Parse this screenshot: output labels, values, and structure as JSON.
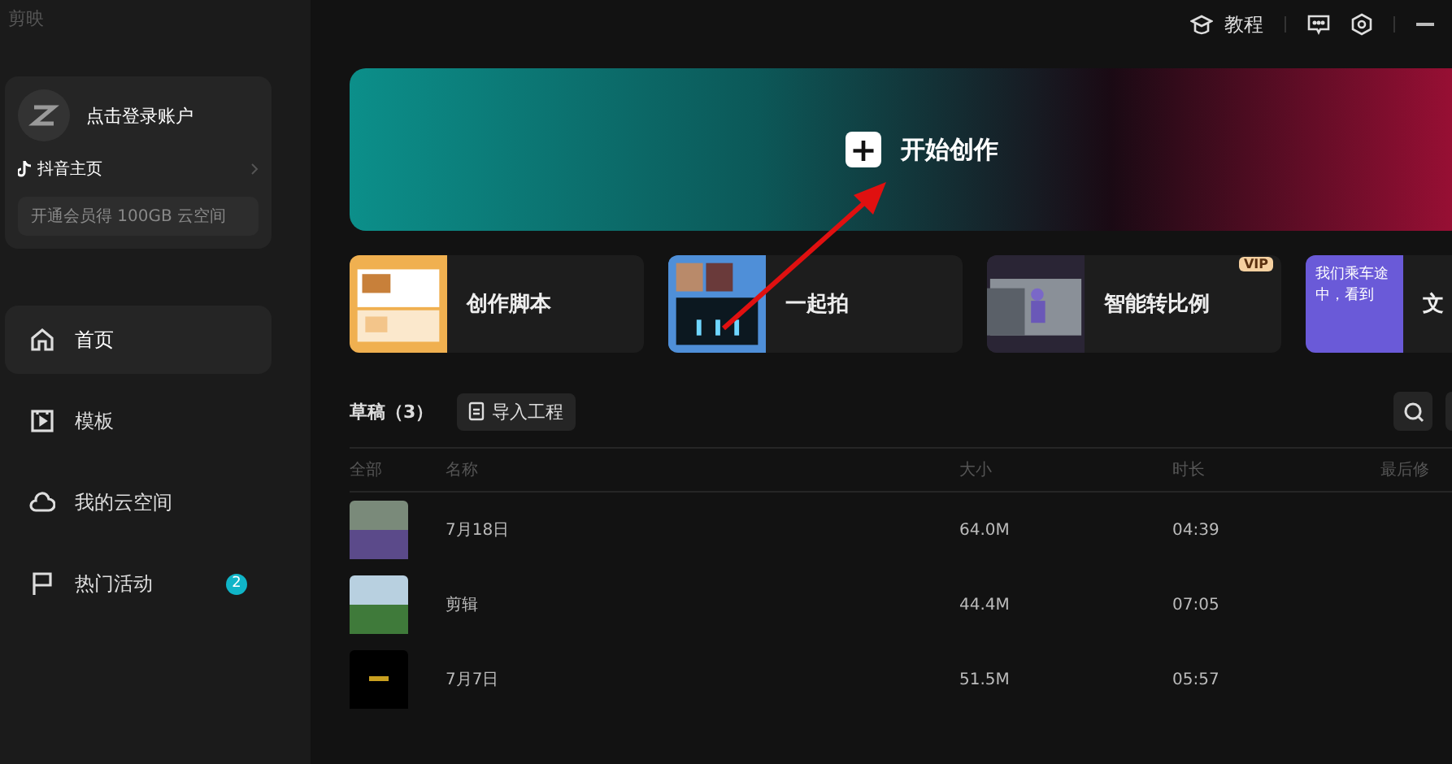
{
  "app_title": "剪映",
  "account": {
    "login": "点击登录账户",
    "douyin": "抖音主页",
    "vip_promo": "开通会员得 100GB 云空间"
  },
  "nav": [
    {
      "label": "首页",
      "selected": true
    },
    {
      "label": "模板",
      "selected": false
    },
    {
      "label": "我的云空间",
      "selected": false
    },
    {
      "label": "热门活动",
      "selected": false,
      "badge": "2"
    }
  ],
  "topbar": {
    "tutorial": "教程"
  },
  "banner": {
    "label": "开始创作",
    "plus": "+"
  },
  "tools": [
    {
      "label": "创作脚本"
    },
    {
      "label": "一起拍"
    },
    {
      "label": "智能转比例",
      "vip_label": "VIP"
    },
    {
      "label": "文",
      "thumb_text": "我们乘车途中，看到"
    }
  ],
  "drafts": {
    "title": "草稿（3）",
    "import": "导入工程",
    "columns": [
      "全部",
      "名称",
      "大小",
      "时长",
      "最后修"
    ],
    "rows": [
      {
        "name": "7月18日",
        "size": "64.0M",
        "duration": "04:39"
      },
      {
        "name": "剪辑",
        "size": "44.4M",
        "duration": "07:05"
      },
      {
        "name": "7月7日",
        "size": "51.5M",
        "duration": "05:57"
      }
    ]
  }
}
